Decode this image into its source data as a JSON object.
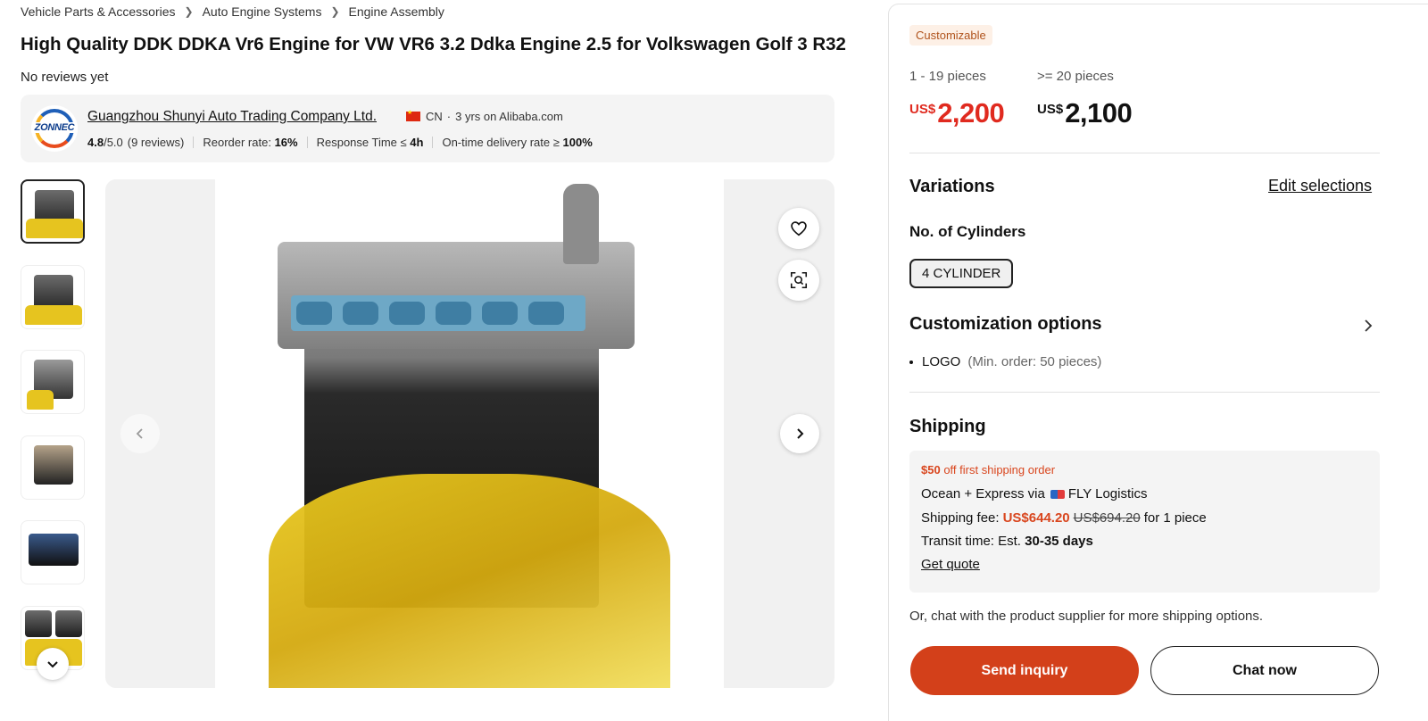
{
  "breadcrumb": [
    "Vehicle Parts & Accessories",
    "Auto Engine Systems",
    "Engine Assembly"
  ],
  "product": {
    "title": "High Quality DDK DDKA Vr6 Engine for VW VR6 3.2 Ddka Engine 2.5 for Volkswagen Golf 3 R32",
    "reviews": "No reviews yet"
  },
  "supplier": {
    "logo_text": "ZONNEC",
    "name": "Guangzhou Shunyi Auto Trading Company Ltd.",
    "country": "CN",
    "years": "3 yrs on Alibaba.com",
    "rating": "4.8",
    "rating_max": "/5.0",
    "rating_count": "(9 reviews)",
    "reorder_label": "Reorder rate:",
    "reorder_value": "16%",
    "response_label": "Response Time ≤",
    "response_value": "4h",
    "delivery_label": "On-time delivery rate ≥",
    "delivery_value": "100%"
  },
  "gallery": {
    "thumb_count": 6,
    "active_index": 0,
    "icons": [
      "chevron-left-icon",
      "chevron-right-icon",
      "heart-icon",
      "image-search-icon",
      "chevron-down-icon"
    ]
  },
  "pricing": {
    "badge": "Customizable",
    "tiers": [
      {
        "range": "1 - 19 pieces",
        "currency": "US$",
        "amount": "2,200"
      },
      {
        "range": ">= 20 pieces",
        "currency": "US$",
        "amount": "2,100"
      }
    ]
  },
  "variations": {
    "title": "Variations",
    "edit_label": "Edit selections",
    "cylinders_label": "No. of Cylinders",
    "cylinders_option": "4 CYLINDER"
  },
  "customization": {
    "title": "Customization options",
    "item": "LOGO",
    "item_note": "(Min. order: 50 pieces)"
  },
  "shipping": {
    "title": "Shipping",
    "promo_amount": "$50",
    "promo_text": "off first shipping order",
    "method_prefix": "Ocean + Express via",
    "carrier": "FLY Logistics",
    "fee_label": "Shipping fee:",
    "fee": "US$644.20",
    "fee_original": "US$694.20",
    "fee_suffix": "for 1 piece",
    "transit_label": "Transit time: Est.",
    "transit_value": "30-35 days",
    "quote_label": "Get quote",
    "chat_note": "Or, chat with the product supplier for more shipping options."
  },
  "actions": {
    "inquiry": "Send inquiry",
    "chat": "Chat now"
  },
  "colors": {
    "accent": "#d3401a",
    "price_red": "#e02a1f",
    "badge_bg": "#fdf0e6"
  }
}
